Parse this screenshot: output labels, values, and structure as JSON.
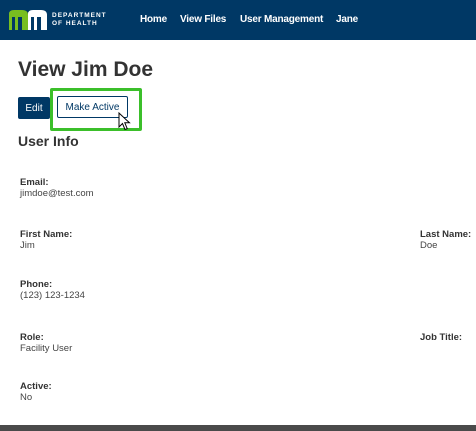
{
  "nav": {
    "logo_line1": "DEPARTMENT",
    "logo_line2": "OF HEALTH",
    "links": [
      "Home",
      "View Files",
      "User Management",
      "Jane"
    ]
  },
  "page": {
    "title": "View Jim Doe",
    "edit_label": "Edit",
    "make_active_label": "Make Active",
    "section_title": "User Info"
  },
  "fields": {
    "email": {
      "label": "Email:",
      "value": "jimdoe@test.com"
    },
    "first_name": {
      "label": "First Name:",
      "value": "Jim"
    },
    "last_name": {
      "label": "Last Name:",
      "value": "Doe"
    },
    "phone": {
      "label": "Phone:",
      "value": "(123) 123-1234"
    },
    "role": {
      "label": "Role:",
      "value": "Facility User"
    },
    "job_title": {
      "label": "Job Title:",
      "value": ""
    },
    "active": {
      "label": "Active:",
      "value": "No"
    }
  },
  "colors": {
    "navbar": "#003865",
    "highlight": "#3bbf2a"
  }
}
